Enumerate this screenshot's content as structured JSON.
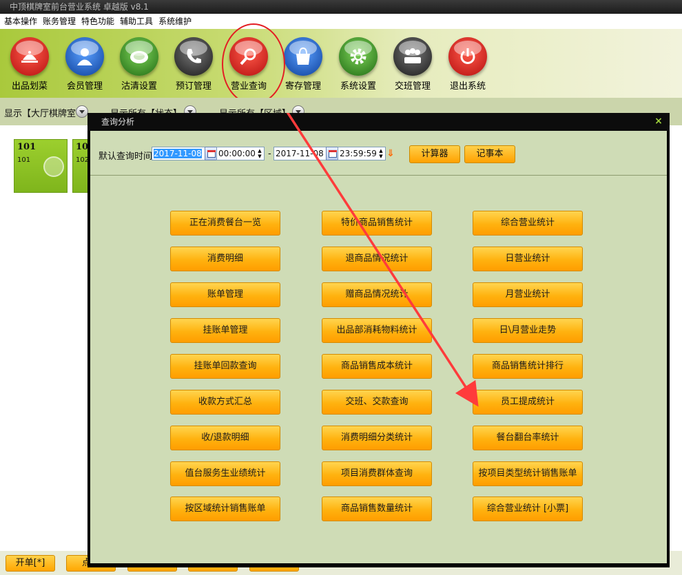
{
  "window": {
    "title": "中顶棋牌室前台营业系统 卓越版 v8.1"
  },
  "menu": [
    "基本操作",
    "账务管理",
    "特色功能",
    "辅助工具",
    "系统维护"
  ],
  "toolbar": [
    {
      "label": "出品划菜",
      "icon": "serving-cloche-icon",
      "color": "#d81e1e"
    },
    {
      "label": "会员管理",
      "icon": "member-user-icon",
      "color": "#1e62c8"
    },
    {
      "label": "沽清设置",
      "icon": "plate-icon",
      "color": "#3f9a2a"
    },
    {
      "label": "预订管理",
      "icon": "phone-icon",
      "color": "#333333"
    },
    {
      "label": "营业查询",
      "icon": "magnifier-icon",
      "color": "#d81e1e"
    },
    {
      "label": "寄存管理",
      "icon": "bag-icon",
      "color": "#1e62c8"
    },
    {
      "label": "系统设置",
      "icon": "gear-icon",
      "color": "#3f9a2a"
    },
    {
      "label": "交班管理",
      "icon": "handover-people-icon",
      "color": "#333333"
    },
    {
      "label": "退出系统",
      "icon": "power-icon",
      "color": "#d81e1e"
    }
  ],
  "filter": {
    "display_label": "显示【大厅棋牌室",
    "all_status": "显示所有【状态】",
    "all_area": "显示所有【区域】"
  },
  "tables": [
    {
      "number": "101",
      "sub": "101"
    },
    {
      "number": "10",
      "sub": "102"
    }
  ],
  "bottom_buttons": [
    "开单[*]",
    "点单",
    "",
    "",
    ""
  ],
  "dialog": {
    "title": "查询分析",
    "close": "×",
    "query_label": "默认查询时间",
    "start_date": "2017-11-08",
    "start_time": "00:00:00",
    "dash": "-",
    "end_date": "2017-11-08",
    "end_time": "23:59:59",
    "calculator": "计算器",
    "notepad": "记事本",
    "columns": [
      [
        "正在消费餐台一览",
        "消费明细",
        "账单管理",
        "挂账单管理",
        "挂账单回款查询",
        "收款方式汇总",
        "收/退款明细",
        "值台服务生业绩统计",
        "按区域统计销售账单"
      ],
      [
        "特价商品销售统计",
        "退商品情况统计",
        "赠商品情况统计",
        "出品部消耗物料统计",
        "商品销售成本统计",
        "交班、交款查询",
        "消费明细分类统计",
        "项目消费群体查询",
        "商品销售数量统计"
      ],
      [
        "综合营业统计",
        "日营业统计",
        "月营业统计",
        "日\\月营业走势",
        "商品销售统计排行",
        "员工提成统计",
        "餐台翻台率统计",
        "按项目类型统计销售账单",
        "综合营业统计 [小票]"
      ]
    ]
  },
  "colors": {
    "accent_orange": "#ffb20f",
    "annotation_red": "#e31e24",
    "panel_green": "#cfdcb6"
  }
}
